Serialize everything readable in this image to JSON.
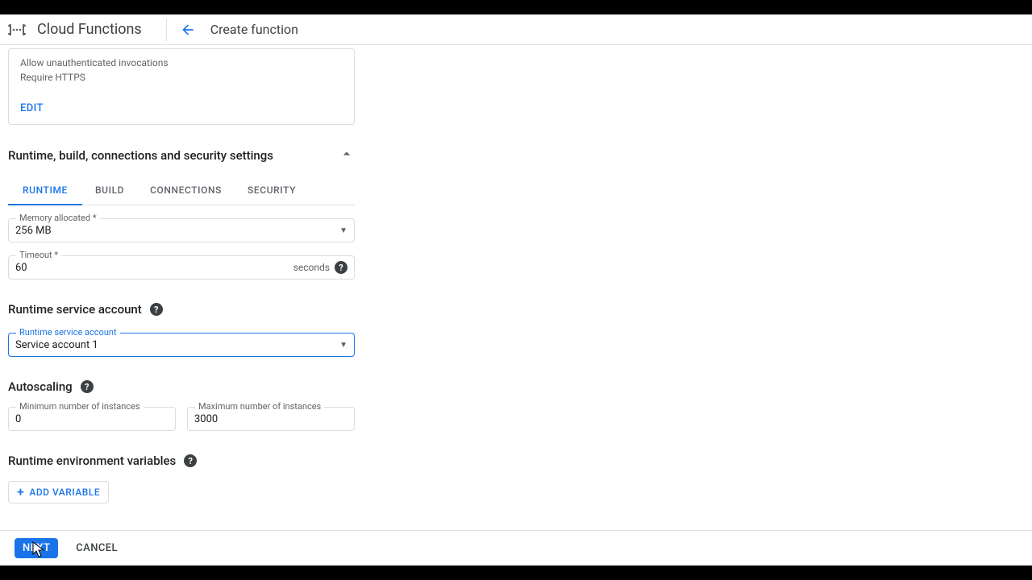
{
  "header": {
    "product": "Cloud Functions",
    "page": "Create function"
  },
  "trigger": {
    "line1": "Allow unauthenticated invocations",
    "line2": "Require HTTPS",
    "edit": "EDIT"
  },
  "section": {
    "title": "Runtime, build, connections and security settings"
  },
  "tabs": {
    "runtime": "RUNTIME",
    "build": "BUILD",
    "connections": "CONNECTIONS",
    "security": "SECURITY"
  },
  "memory": {
    "label": "Memory allocated *",
    "value": "256 MB"
  },
  "timeout": {
    "label": "Timeout *",
    "value": "60",
    "unit": "seconds"
  },
  "serviceAccount": {
    "heading": "Runtime service account",
    "label": "Runtime service account",
    "value": "Service account 1"
  },
  "autoscaling": {
    "heading": "Autoscaling",
    "minLabel": "Minimum number of instances",
    "minValue": "0",
    "maxLabel": "Maximum number of instances",
    "maxValue": "3000"
  },
  "envVars": {
    "heading": "Runtime environment variables",
    "addButton": "ADD VARIABLE"
  },
  "footer": {
    "next": "NEXT",
    "cancel": "CANCEL"
  }
}
